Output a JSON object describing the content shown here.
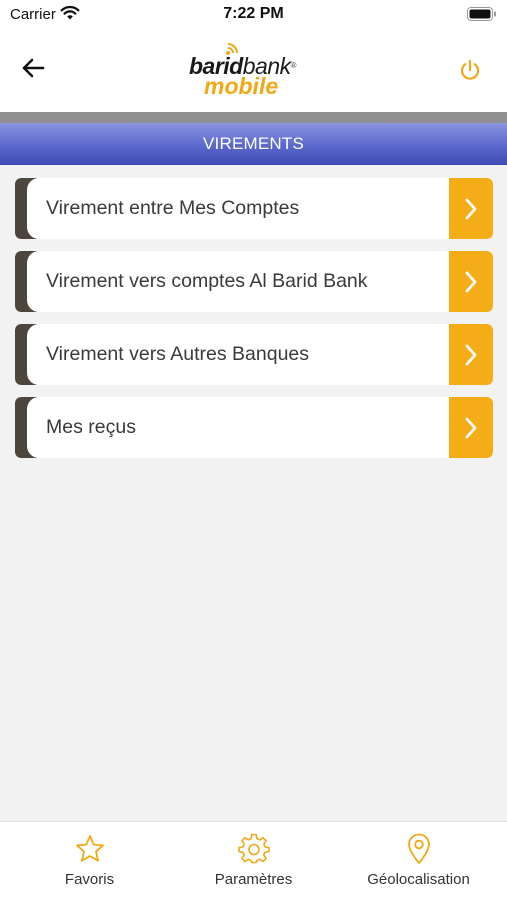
{
  "status_bar": {
    "carrier": "Carrier",
    "time": "7:22 PM"
  },
  "header": {
    "logo": {
      "part1": "barid",
      "part2": "bank",
      "reg": "®",
      "part3": "mobile"
    }
  },
  "page_title": "VIREMENTS",
  "menu": {
    "items": [
      {
        "label": "Virement entre Mes Comptes"
      },
      {
        "label": "Virement vers comptes Al Barid Bank"
      },
      {
        "label": "Virement vers Autres Banques"
      },
      {
        "label": "Mes reçus"
      }
    ]
  },
  "tab_bar": {
    "tabs": [
      {
        "label": "Favoris",
        "icon": "star-icon"
      },
      {
        "label": "Paramètres",
        "icon": "gear-icon"
      },
      {
        "label": "Géolocalisation",
        "icon": "location-pin-icon"
      }
    ]
  },
  "colors": {
    "accent": "#f4ad16",
    "title_bar": "#5b68cc",
    "item_marker": "#4d463c"
  }
}
